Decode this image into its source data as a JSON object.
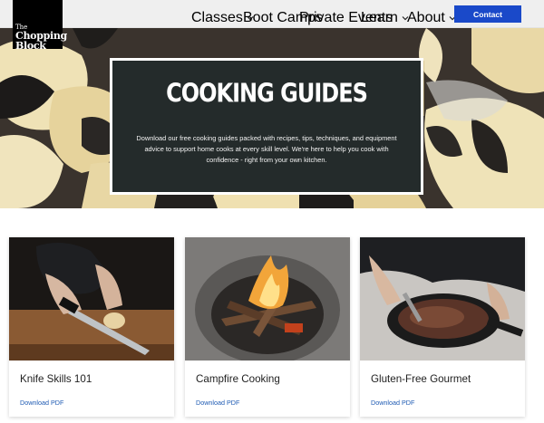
{
  "brand": {
    "logo_line1": "The",
    "logo_line2": "Chopping",
    "logo_line3": "Block"
  },
  "nav": {
    "items": [
      {
        "label": "Classes",
        "has_dropdown": true
      },
      {
        "label": "Boot Camps",
        "has_dropdown": false
      },
      {
        "label": "Private Events",
        "has_dropdown": false
      },
      {
        "label": "Learn",
        "has_dropdown": true
      },
      {
        "label": "About",
        "has_dropdown": true
      }
    ],
    "contact_label": "Contact"
  },
  "hero": {
    "title": "COOKING GUIDES",
    "text": "Download our free cooking guides packed with recipes, tips, techniques, and equipment advice to support home cooks at every skill level. We're here to help you cook with confidence - right from your own kitchen."
  },
  "cards": [
    {
      "title": "Knife Skills 101",
      "link": "Download PDF"
    },
    {
      "title": "Campfire Cooking",
      "link": "Download PDF"
    },
    {
      "title": "Gluten-Free Gourmet",
      "link": "Download PDF"
    }
  ],
  "colors": {
    "accent": "#1a49c9",
    "hero_card": "#242b2b",
    "link": "#1f5bb3"
  },
  "icons": {
    "dropdown": "chevron-down-icon"
  }
}
